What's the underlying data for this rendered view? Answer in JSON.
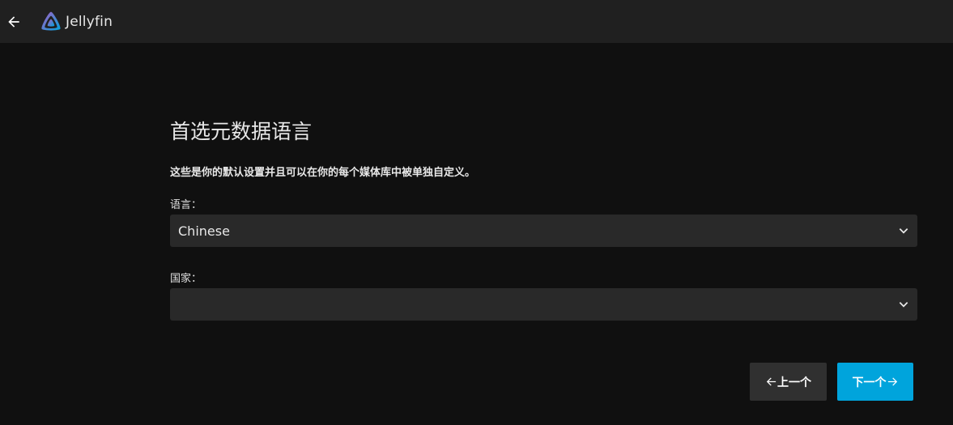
{
  "header": {
    "app_name": "Jellyfin",
    "back_icon": "arrow-left-icon",
    "logo_icon": "jellyfin-logo-icon"
  },
  "page": {
    "title": "首选元数据语言",
    "description": "这些是你的默认设置并且可以在你的每个媒体库中被单独自定义。"
  },
  "form": {
    "language_label": "语言：",
    "language_value": "Chinese",
    "country_label": "国家：",
    "country_value": ""
  },
  "buttons": {
    "prev_label": "上一个",
    "next_label": "下一个"
  },
  "colors": {
    "accent": "#00a4dc",
    "header_bg": "#202020",
    "page_bg": "#101010",
    "select_bg": "#292929"
  }
}
